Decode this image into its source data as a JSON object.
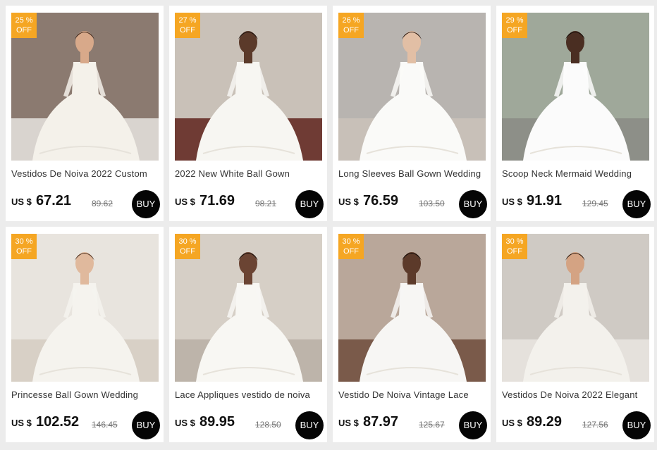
{
  "products": [
    {
      "discount": "25 %",
      "off": "OFF",
      "title": "Vestidos De Noiva 2022 Custom",
      "currency": "US $",
      "price": "67.21",
      "old_price": "89.62",
      "buy": "BUY",
      "scene": {
        "bg": "#8b7a70",
        "floor": "#d9d4cf",
        "dress": "#f4f1ea",
        "skin": "#d8a98a",
        "hair": "#3a2418"
      }
    },
    {
      "discount": "27 %",
      "off": "OFF",
      "title": "2022 New White Ball Gown",
      "currency": "US $",
      "price": "71.69",
      "old_price": "98.21",
      "buy": "BUY",
      "scene": {
        "bg": "#c9c1b8",
        "floor": "#6f3b34",
        "dress": "#f7f6f2",
        "skin": "#5b3a2a",
        "hair": "#1c120d"
      }
    },
    {
      "discount": "26 %",
      "off": "OFF",
      "title": "Long Sleeves Ball Gown Wedding",
      "currency": "US $",
      "price": "76.59",
      "old_price": "103.50",
      "buy": "BUY",
      "scene": {
        "bg": "#b8b4b0",
        "floor": "#c8c0b8",
        "dress": "#fafaf8",
        "skin": "#e2bfa5",
        "hair": "#2a1a12"
      }
    },
    {
      "discount": "29 %",
      "off": "OFF",
      "title": "Scoop Neck Mermaid Wedding",
      "currency": "US $",
      "price": "91.91",
      "old_price": "129.45",
      "buy": "BUY",
      "scene": {
        "bg": "#9fa89a",
        "floor": "#8d8f88",
        "dress": "#fbfbfb",
        "skin": "#4a2e22",
        "hair": "#140c08"
      }
    },
    {
      "discount": "30 %",
      "off": "OFF",
      "title": "Princesse Ball Gown Wedding",
      "currency": "US $",
      "price": "102.52",
      "old_price": "146.45",
      "buy": "BUY",
      "scene": {
        "bg": "#e8e4de",
        "floor": "#d8d0c6",
        "dress": "#f5f3ee",
        "skin": "#e0b99d",
        "hair": "#4b3020"
      }
    },
    {
      "discount": "30 %",
      "off": "OFF",
      "title": "Lace Appliques vestido de noiva",
      "currency": "US $",
      "price": "89.95",
      "old_price": "128.50",
      "buy": "BUY",
      "scene": {
        "bg": "#d6cfc6",
        "floor": "#bdb4aa",
        "dress": "#f8f7f3",
        "skin": "#6b4433",
        "hair": "#1a100b"
      }
    },
    {
      "discount": "30 %",
      "off": "OFF",
      "title": "Vestido De Noiva Vintage Lace",
      "currency": "US $",
      "price": "87.97",
      "old_price": "125.67",
      "buy": "BUY",
      "scene": {
        "bg": "#b9a79a",
        "floor": "#7a5a4a",
        "dress": "#f7f6f4",
        "skin": "#5c3a2a",
        "hair": "#150d09"
      }
    },
    {
      "discount": "30 %",
      "off": "OFF",
      "title": "Vestidos De Noiva 2022 Elegant",
      "currency": "US $",
      "price": "89.29",
      "old_price": "127.56",
      "buy": "BUY",
      "scene": {
        "bg": "#cfcac4",
        "floor": "#e5e1dc",
        "dress": "#f3f1ec",
        "skin": "#d4a383",
        "hair": "#2d1c12"
      }
    }
  ]
}
